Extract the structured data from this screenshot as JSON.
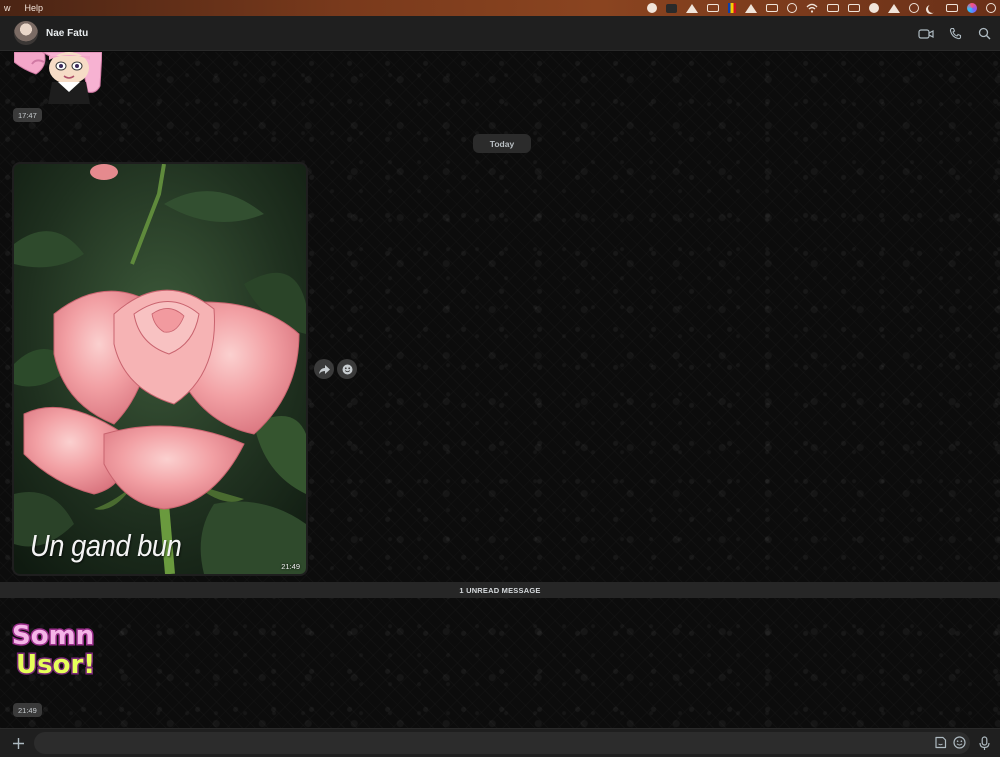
{
  "menubar": {
    "left_partial": "w",
    "help": "Help",
    "status_icons": [
      "telegram-icon",
      "app-icon",
      "layers-icon",
      "battery-extension-icon",
      "flag-icon",
      "location-off-icon",
      "battery-icon",
      "clock-icon",
      "wifi-icon",
      "display-icon",
      "keyboard-icon",
      "weather-icon",
      "mute-icon",
      "user-icon",
      "moon-icon",
      "control-center-icon",
      "siri-icon",
      "info-icon"
    ]
  },
  "header": {
    "contact_name": "Nae Fatu",
    "actions": [
      "video-call-icon",
      "voice-call-icon",
      "search-icon"
    ]
  },
  "messages": {
    "sticker_top_time": "17:47",
    "date_separator": "Today",
    "image_caption": "Un gand bun",
    "image_time": "21:49",
    "unread_banner": "1 UNREAD MESSAGE",
    "sticker_bottom_line1": "Somn",
    "sticker_bottom_line2": "Usor!",
    "sticker_bottom_time": "21:49"
  },
  "composer": {
    "value": "",
    "placeholder": ""
  },
  "colors": {
    "menubar": "#7a3a1c",
    "header": "#1f1f1f",
    "chat_bg": "#0c0c0c",
    "pill": "#3a3a3a",
    "rose": "#f2a0a4",
    "leaf": "#2f4a2c"
  }
}
